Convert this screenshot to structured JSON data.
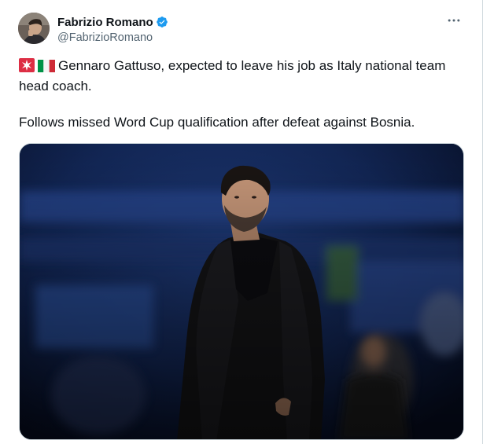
{
  "author": {
    "display_name": "Fabrizio Romano",
    "handle": "@FabrizioRomano",
    "verified": true,
    "avatar_icon": "profile-photo"
  },
  "actions": {
    "more_icon": "more-horizontal-icon"
  },
  "tweet": {
    "emoji_1": "siren-emoji",
    "emoji_2": "italy-flag-emoji",
    "line_1": "Gennaro Gattuso, expected to leave his job as Italy national team head coach.",
    "line_2": "Follows missed Word Cup qualification after defeat against Bosnia."
  },
  "media": {
    "type": "photo",
    "subject": "man in dark coat standing in stadium at night"
  },
  "colors": {
    "text": "#0f1419",
    "secondary": "#536471",
    "verified": "#1d9bf0",
    "border": "#cfd9de"
  }
}
